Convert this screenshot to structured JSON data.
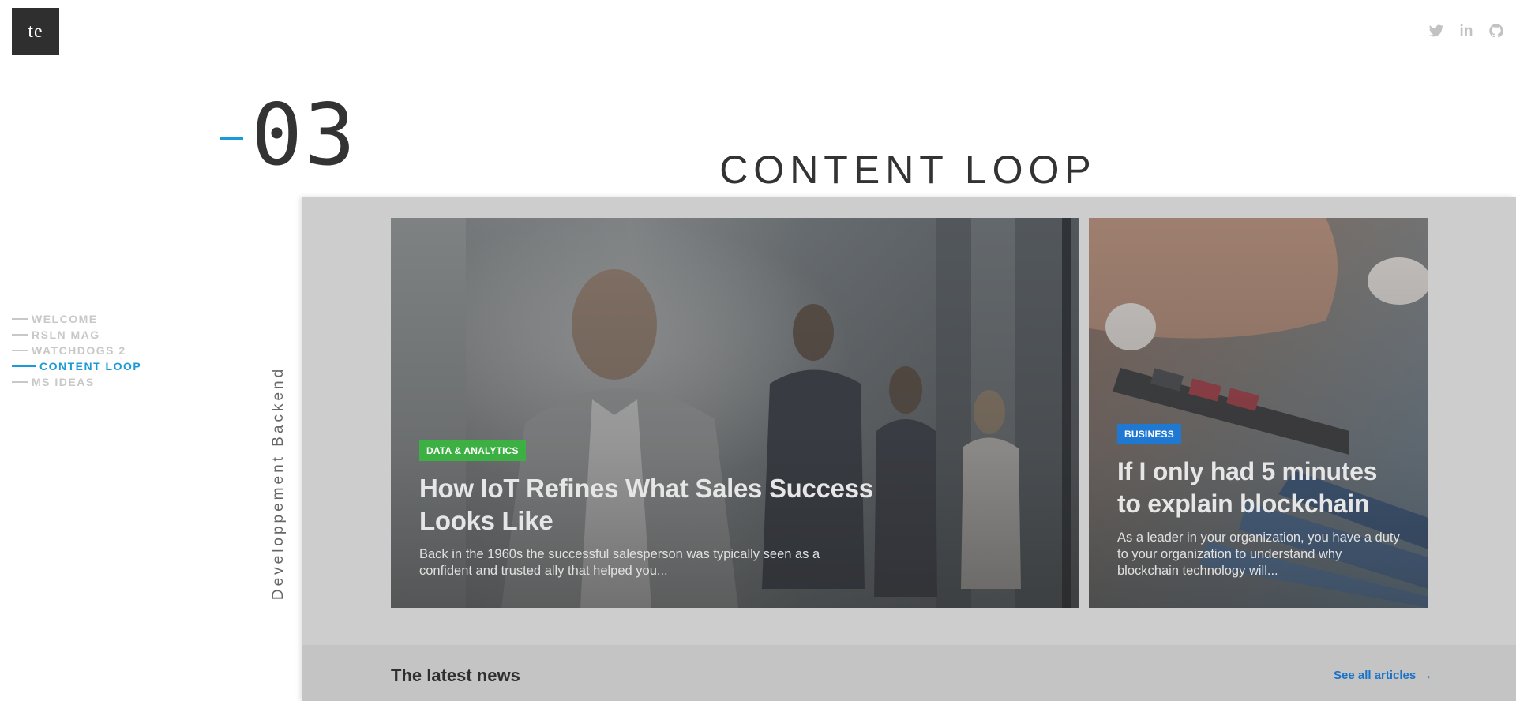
{
  "logo": {
    "text": "te"
  },
  "social": [
    {
      "name": "twitter-icon"
    },
    {
      "name": "linkedin-icon",
      "text": "in"
    },
    {
      "name": "github-icon"
    }
  ],
  "section": {
    "number": "03",
    "title": "CONTENT LOOP",
    "category": "Developpement Backend"
  },
  "nav": {
    "items": [
      {
        "label": "WELCOME",
        "active": false
      },
      {
        "label": "RSLN MAG",
        "active": false
      },
      {
        "label": "WATCHDOGS 2",
        "active": false
      },
      {
        "label": "CONTENT LOOP",
        "active": true
      },
      {
        "label": "MS IDEAS",
        "active": false
      }
    ]
  },
  "preview": {
    "cards": [
      {
        "tag": "DATA & ANALYTICS",
        "tag_color": "#3cb043",
        "title": "How IoT Refines What Sales Success Looks Like",
        "excerpt": "Back in the 1960s the successful salesperson was typically seen as a confident and trusted ally that helped you..."
      },
      {
        "tag": "BUSINESS",
        "tag_color": "#1f78d1",
        "title": "If I only had 5 minutes to explain blockchain",
        "excerpt": "As a leader in your organization, you have a duty to your organization to understand why blockchain technology will..."
      }
    ],
    "news": {
      "title": "The latest news",
      "see_all": "See all articles"
    }
  },
  "colors": {
    "accent": "#1a9ad6",
    "logo_bg": "#2f2f2f",
    "nav_inactive": "#c8c8c8",
    "panel_bg": "#cdcdcd"
  }
}
